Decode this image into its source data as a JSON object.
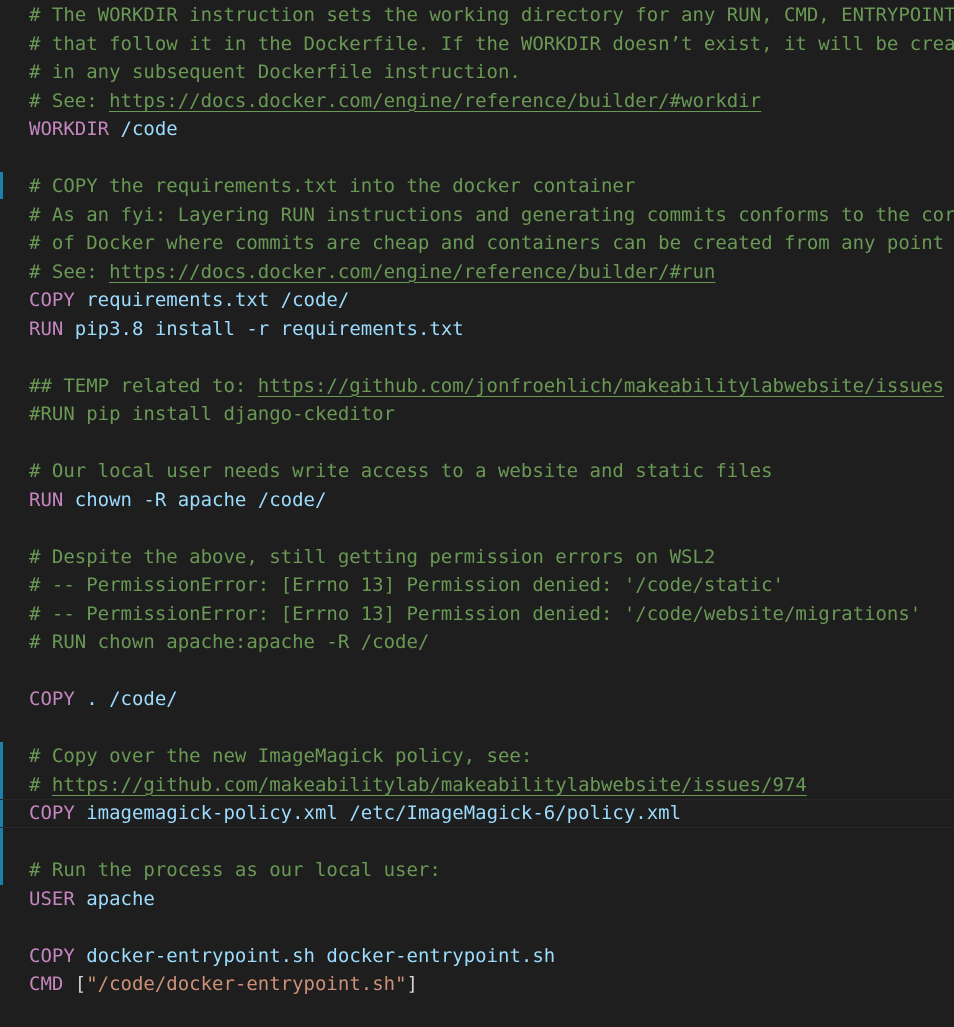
{
  "editor": {
    "language": "dockerfile",
    "theme": "dark",
    "colors": {
      "background": "#1e1e1e",
      "comment": "#6a9955",
      "keyword": "#c586c0",
      "argument": "#9cdcfe",
      "string": "#ce9178",
      "plain": "#d4d4d4",
      "gutter_modified": "#1b81a8"
    },
    "current_line_index": 28,
    "lines": [
      [
        {
          "t": "c",
          "v": "# The WORKDIR instruction sets the working directory for any RUN, CMD, ENTRYPOINT"
        }
      ],
      [
        {
          "t": "c",
          "v": "# that follow it in the Dockerfile. If the WORKDIR doesn’t exist, it will be created"
        }
      ],
      [
        {
          "t": "c",
          "v": "# in any subsequent Dockerfile instruction."
        }
      ],
      [
        {
          "t": "c",
          "v": "# See: "
        },
        {
          "t": "u",
          "v": "https://docs.docker.com/engine/reference/builder/#workdir"
        }
      ],
      [
        {
          "t": "k",
          "v": "WORKDIR"
        },
        {
          "t": "p",
          "v": " "
        },
        {
          "t": "a",
          "v": "/code"
        }
      ],
      [],
      [
        {
          "t": "c",
          "v": "# COPY the requirements.txt into the docker container"
        }
      ],
      [
        {
          "t": "c",
          "v": "# As an fyi: Layering RUN instructions and generating commits conforms to the core concepts"
        }
      ],
      [
        {
          "t": "c",
          "v": "# of Docker where commits are cheap and containers can be created from any point in an image's history"
        }
      ],
      [
        {
          "t": "c",
          "v": "# See: "
        },
        {
          "t": "u",
          "v": "https://docs.docker.com/engine/reference/builder/#run"
        }
      ],
      [
        {
          "t": "k",
          "v": "COPY"
        },
        {
          "t": "p",
          "v": " "
        },
        {
          "t": "a",
          "v": "requirements.txt /code/"
        }
      ],
      [
        {
          "t": "k",
          "v": "RUN"
        },
        {
          "t": "p",
          "v": " "
        },
        {
          "t": "a",
          "v": "pip3.8 install -r requirements.txt"
        }
      ],
      [],
      [
        {
          "t": "c",
          "v": "## TEMP related to: "
        },
        {
          "t": "u",
          "v": "https://github.com/jonfroehlich/makeabilitylabwebsite/issues"
        }
      ],
      [
        {
          "t": "c",
          "v": "#RUN pip install django-ckeditor"
        }
      ],
      [],
      [
        {
          "t": "c",
          "v": "# Our local user needs write access to a website and static files"
        }
      ],
      [
        {
          "t": "k",
          "v": "RUN"
        },
        {
          "t": "p",
          "v": " "
        },
        {
          "t": "a",
          "v": "chown -R apache /code/"
        }
      ],
      [],
      [
        {
          "t": "c",
          "v": "# Despite the above, still getting permission errors on WSL2"
        }
      ],
      [
        {
          "t": "c",
          "v": "# -- PermissionError: [Errno 13] Permission denied: '/code/static'"
        }
      ],
      [
        {
          "t": "c",
          "v": "# -- PermissionError: [Errno 13] Permission denied: '/code/website/migrations'"
        }
      ],
      [
        {
          "t": "c",
          "v": "# RUN chown apache:apache -R /code/"
        }
      ],
      [],
      [
        {
          "t": "k",
          "v": "COPY"
        },
        {
          "t": "p",
          "v": " "
        },
        {
          "t": "a",
          "v": ". /code/"
        }
      ],
      [],
      [
        {
          "t": "c",
          "v": "# Copy over the new ImageMagick policy, see:"
        }
      ],
      [
        {
          "t": "c",
          "v": "# "
        },
        {
          "t": "u",
          "v": "https://github.com/makeabilitylab/makeabilitylabwebsite/issues/974"
        }
      ],
      [
        {
          "t": "k",
          "v": "COPY"
        },
        {
          "t": "p",
          "v": " "
        },
        {
          "t": "a",
          "v": "imagemagick-policy.xml /etc/ImageMagick-6/policy.xml"
        }
      ],
      [],
      [
        {
          "t": "c",
          "v": "# Run the process as our local user:"
        }
      ],
      [
        {
          "t": "k",
          "v": "USER"
        },
        {
          "t": "p",
          "v": " "
        },
        {
          "t": "a",
          "v": "apache"
        }
      ],
      [],
      [
        {
          "t": "k",
          "v": "COPY"
        },
        {
          "t": "p",
          "v": " "
        },
        {
          "t": "a",
          "v": "docker-entrypoint.sh docker-entrypoint.sh"
        }
      ],
      [
        {
          "t": "k",
          "v": "CMD"
        },
        {
          "t": "p",
          "v": " ["
        },
        {
          "t": "s",
          "v": "\"/code/docker-entrypoint.sh\""
        },
        {
          "t": "p",
          "v": "]"
        }
      ]
    ]
  }
}
